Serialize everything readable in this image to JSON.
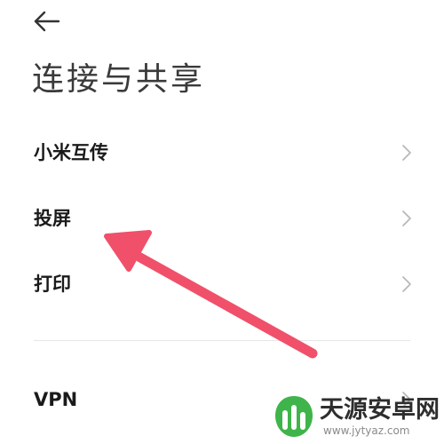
{
  "header": {
    "back_icon": "arrow-left-icon",
    "title": "连接与共享"
  },
  "settings": {
    "items": [
      {
        "label": "小米互传",
        "icon": "chevron-right-icon"
      },
      {
        "label": "投屏",
        "icon": "chevron-right-icon"
      },
      {
        "label": "打印",
        "icon": "chevron-right-icon"
      },
      {
        "label": "VPN",
        "icon": "chevron-right-icon"
      }
    ]
  },
  "annotation": {
    "icon": "pointer-arrow-icon",
    "color": "#f0506a"
  },
  "watermark": {
    "brand": "天源安卓网",
    "url": "www.jytyaz.com",
    "logo_color": "#3fb44a"
  }
}
